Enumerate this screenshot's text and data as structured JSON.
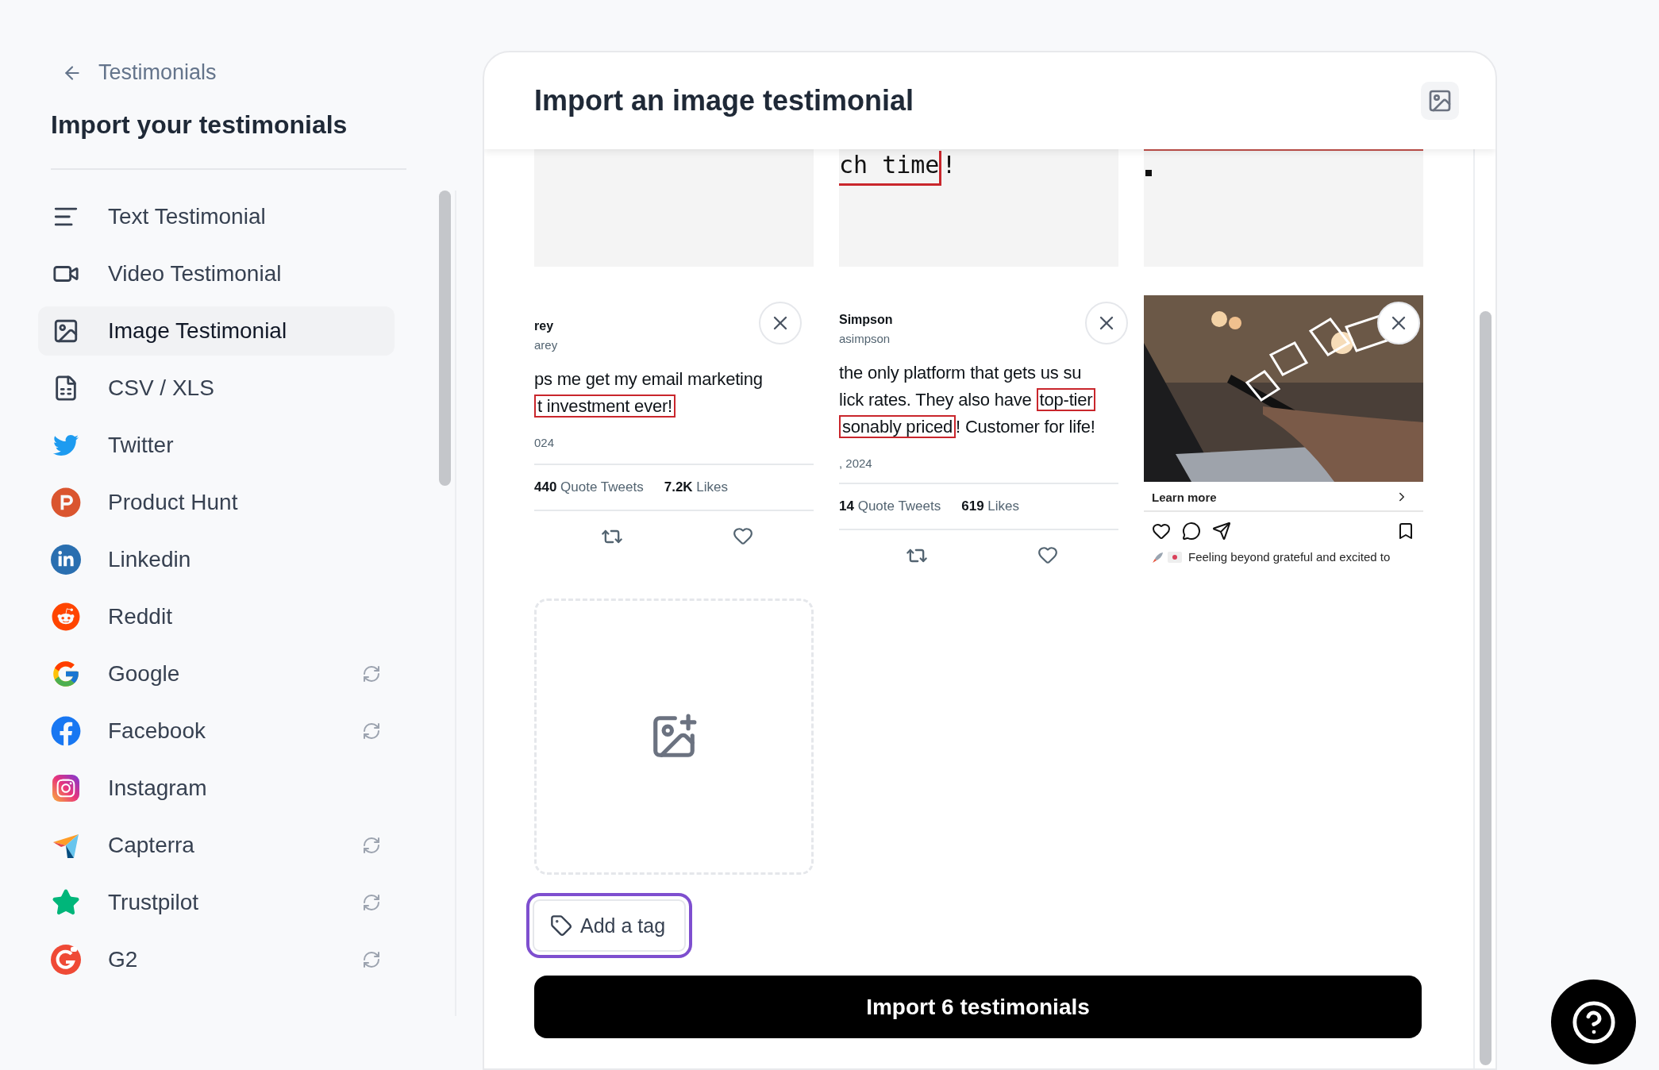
{
  "back_link": {
    "label": "Testimonials"
  },
  "sidebar": {
    "title": "Import your testimonials",
    "items": [
      {
        "label": "Text Testimonial",
        "selected": false,
        "sync": false
      },
      {
        "label": "Video Testimonial",
        "selected": false,
        "sync": false
      },
      {
        "label": "Image Testimonial",
        "selected": true,
        "sync": false
      },
      {
        "label": "CSV / XLS",
        "selected": false,
        "sync": false
      },
      {
        "label": "Twitter",
        "selected": false,
        "sync": false
      },
      {
        "label": "Product Hunt",
        "selected": false,
        "sync": false
      },
      {
        "label": "Linkedin",
        "selected": false,
        "sync": false
      },
      {
        "label": "Reddit",
        "selected": false,
        "sync": false
      },
      {
        "label": "Google",
        "selected": false,
        "sync": true
      },
      {
        "label": "Facebook",
        "selected": false,
        "sync": true
      },
      {
        "label": "Instagram",
        "selected": false,
        "sync": false
      },
      {
        "label": "Capterra",
        "selected": false,
        "sync": true
      },
      {
        "label": "Trustpilot",
        "selected": false,
        "sync": true
      },
      {
        "label": "G2",
        "selected": false,
        "sync": true
      }
    ]
  },
  "panel": {
    "title": "Import an image testimonial",
    "top_row": [
      {
        "kind": "blank"
      },
      {
        "kind": "code",
        "segments": [
          {
            "text": "ch time",
            "boxed": true
          },
          {
            "text": "!",
            "boxed": false
          }
        ]
      },
      {
        "kind": "mark"
      }
    ],
    "cards": [
      {
        "kind": "tweet",
        "name": "rey",
        "handle": "arey",
        "lines": [
          [
            {
              "text": "ps me get my email marketing",
              "boxed": false
            }
          ],
          [
            {
              "text": "t investment ever!",
              "boxed": true
            }
          ]
        ],
        "date": "024",
        "quotes": "440",
        "quotes_label": "Quote Tweets",
        "likes": "7.2K",
        "likes_label": "Likes"
      },
      {
        "kind": "tweet",
        "name": "Simpson",
        "handle": "asimpson",
        "lines": [
          [
            {
              "text": "the only platform that gets us su",
              "boxed": false
            }
          ],
          [
            {
              "text": "lick rates. They also have ",
              "boxed": false
            },
            {
              "text": "top-tier",
              "boxed": true
            }
          ],
          [
            {
              "text": "sonably priced",
              "boxed": true
            },
            {
              "text": "! Customer for life!",
              "boxed": false
            }
          ]
        ],
        "date": ", 2024",
        "quotes": "14",
        "quotes_label": "Quote Tweets",
        "likes": "619",
        "likes_label": "Likes"
      },
      {
        "kind": "instagram",
        "cta": "Learn more",
        "caption": "Feeling beyond grateful and excited to"
      }
    ],
    "tag_button": {
      "label": "Add a tag",
      "focused": true
    },
    "import_button": {
      "label": "Import 6 testimonials"
    }
  }
}
